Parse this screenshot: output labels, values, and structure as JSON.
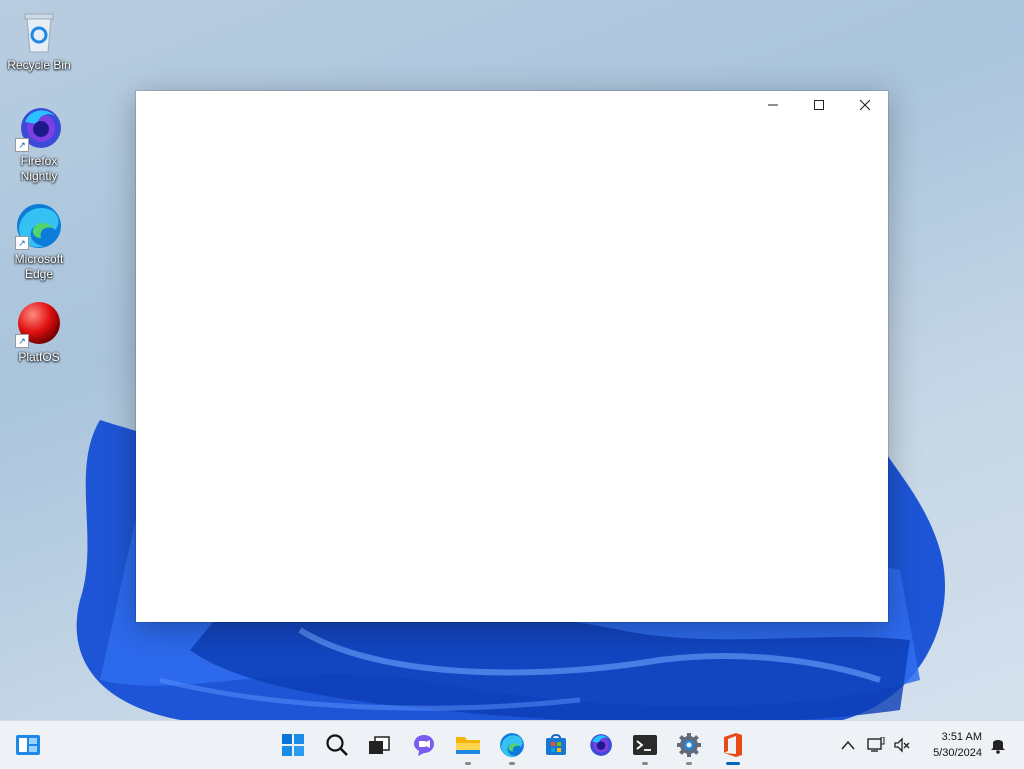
{
  "desktop": {
    "icons": [
      {
        "label": "Recycle Bin"
      },
      {
        "label": "Firefox Nightly"
      },
      {
        "label": "Microsoft Edge"
      },
      {
        "label": "PlatfOS"
      }
    ]
  },
  "window": {
    "controls": [
      "minimize-icon",
      "maximize-icon",
      "close-icon"
    ]
  },
  "taskbar": {
    "widgets": "widgets-icon",
    "pinned": [
      "start-icon",
      "search-icon",
      "task-view-icon",
      "chat-icon",
      "file-explorer-icon",
      "edge-icon",
      "store-icon",
      "firefox-icon",
      "terminal-icon",
      "settings-icon",
      "office-icon"
    ],
    "tray": [
      "chevron-up-icon",
      "network-icon",
      "volume-mute-icon",
      "notification-icon"
    ],
    "clock": {
      "time": "3:51 AM",
      "date": "5/30/2024"
    }
  },
  "colors": {
    "accent": "#0067c0",
    "taskbar": "#eef2f7"
  }
}
